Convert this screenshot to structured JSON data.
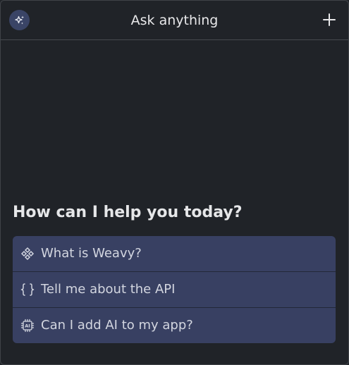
{
  "header": {
    "title": "Ask anything",
    "avatar_icon": "sparkles-icon",
    "add_icon": "plus-icon"
  },
  "main": {
    "greeting": "How can I help you today?",
    "suggestions": [
      {
        "label": "What is Weavy?",
        "icon": "weavy-logo-icon"
      },
      {
        "label": "Tell me about the API",
        "icon": "code-braces-icon"
      },
      {
        "label": "Can I add AI to my app?",
        "icon": "ai-chip-icon"
      }
    ]
  },
  "colors": {
    "background": "#202328",
    "suggestion_background": "#384062",
    "avatar_background": "#3a4466",
    "text": "#e6e7e9",
    "suggestion_text": "#d3d6e0"
  }
}
